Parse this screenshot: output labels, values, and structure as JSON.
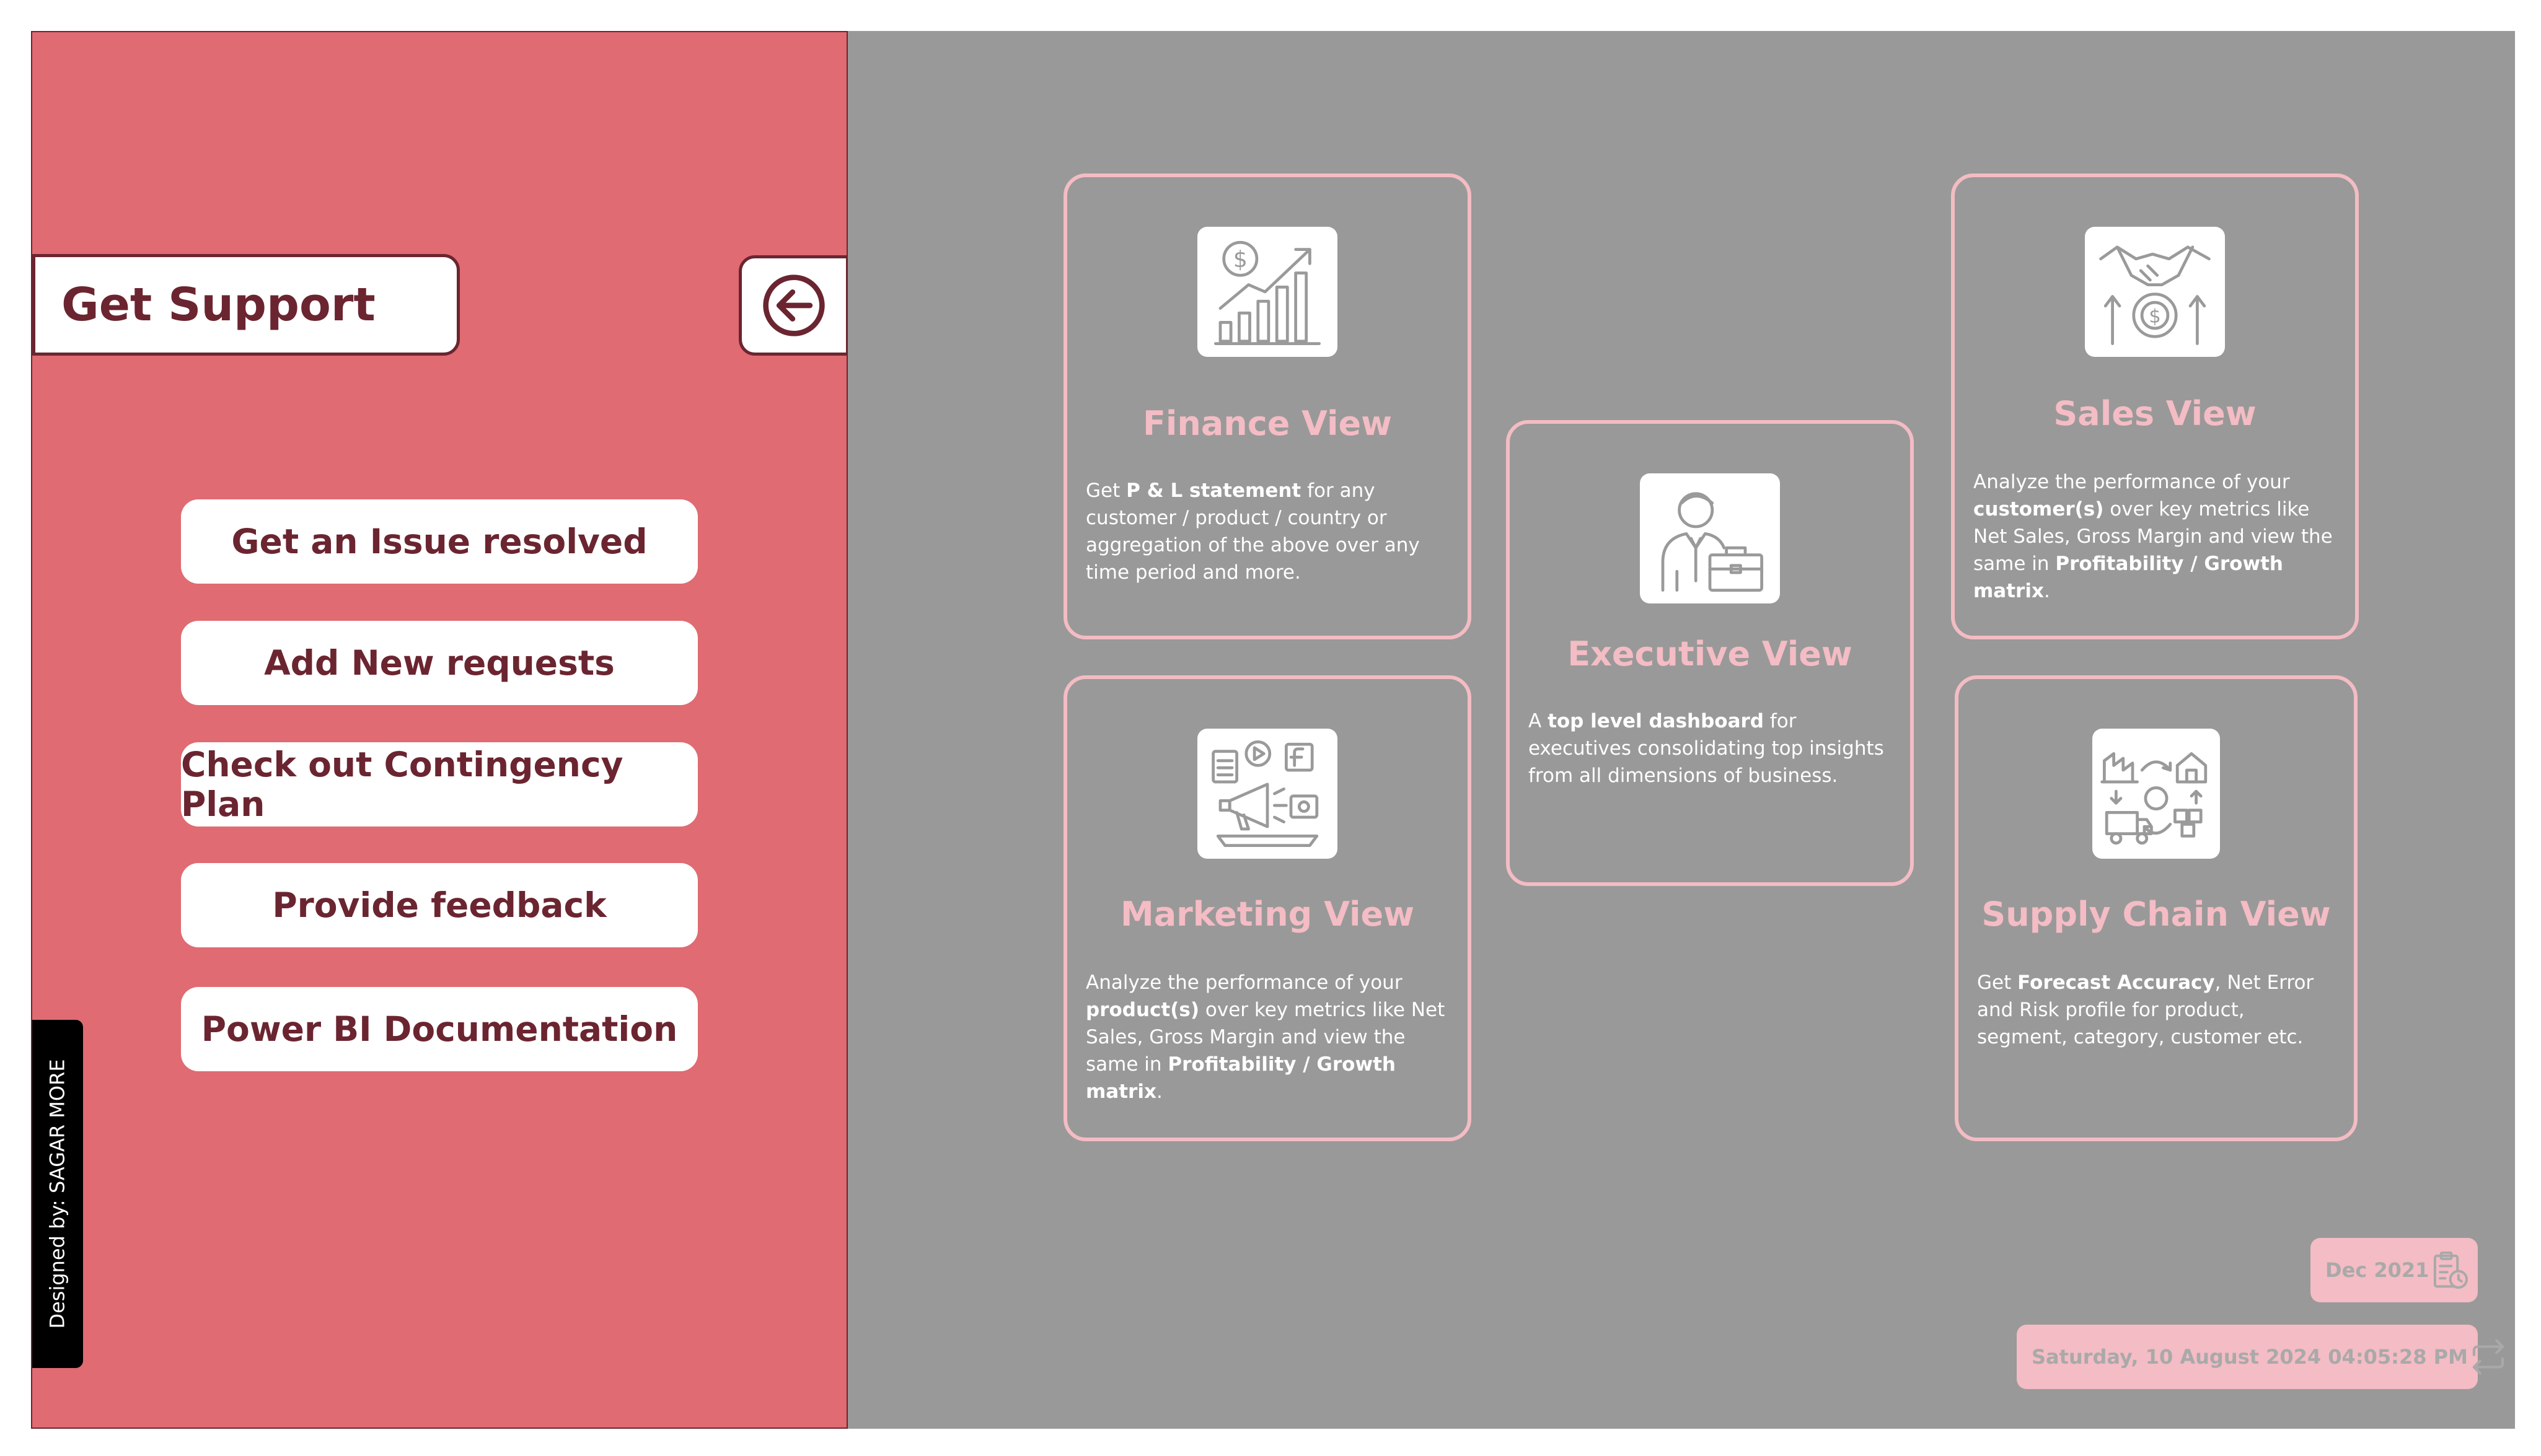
{
  "support_panel": {
    "title": "Get Support",
    "back_button_icon": "arrow-left-circle-icon",
    "menu": [
      {
        "label": "Get an Issue resolved"
      },
      {
        "label": "Add New requests"
      },
      {
        "label": "Check out Contingency Plan"
      },
      {
        "label": "Provide feedback"
      },
      {
        "label": "Power BI Documentation"
      }
    ],
    "designer_credit": "Designed by: SAGAR MORE"
  },
  "views": {
    "finance": {
      "title": "Finance View",
      "icon": "finance-growth-chart-icon",
      "desc": {
        "pre": "Get ",
        "b1": "P & L statement",
        "post": " for any customer / product / country or aggregation of the above over any time period and more."
      }
    },
    "executive": {
      "title": "Executive View",
      "icon": "executive-briefcase-icon",
      "desc": {
        "pre": "A ",
        "b1": "top level dashboard",
        "post": " for executives consolidating top insights from all dimensions of business."
      }
    },
    "sales": {
      "title": "Sales View",
      "icon": "handshake-money-icon",
      "desc": {
        "pre": "Analyze the performance of your ",
        "b1": "customer(s)",
        "mid": " over key metrics like Net Sales, Gross Margin and view the same in ",
        "b2": "Profitability / Growth matrix",
        "post": "."
      }
    },
    "marketing": {
      "title": "Marketing View",
      "icon": "marketing-megaphone-icon",
      "desc": {
        "pre": "Analyze the performance of your ",
        "b1": "product(s)",
        "mid": " over key metrics like Net Sales, Gross Margin and view the same in ",
        "b2": "Profitability / Growth matrix",
        "post": "."
      }
    },
    "supply_chain": {
      "title": "Supply Chain View",
      "icon": "supply-chain-cycle-icon",
      "desc": {
        "pre": "Get ",
        "b1": "Forecast Accuracy",
        "post": ", Net Error and Risk profile for product, segment, category, customer etc."
      }
    }
  },
  "status": {
    "period": "Dec 2021",
    "period_icon": "calendar-clipboard-icon",
    "refreshed": "Saturday, 10 August 2024 04:05:28 PM",
    "refresh_icon": "refresh-icon"
  },
  "colors": {
    "panel": "#e06b72",
    "maroon": "#6b2530",
    "content_bg": "#999999",
    "card_border": "#f3bcc3",
    "pink_text": "#f4bcc4"
  }
}
